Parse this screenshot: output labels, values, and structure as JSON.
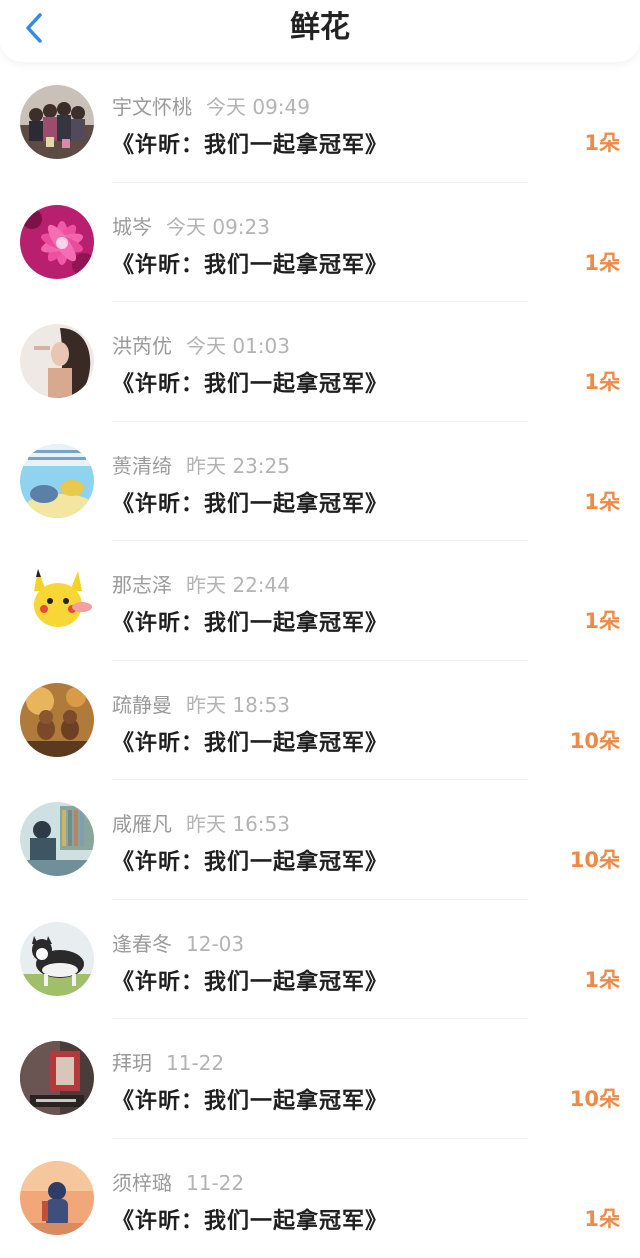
{
  "header": {
    "title": "鲜花"
  },
  "items": [
    {
      "name": "宇文怀桃",
      "time": "今天 09:49",
      "book": "《许昕：我们一起拿冠军》",
      "amount": "1朵"
    },
    {
      "name": "城岑",
      "time": "今天 09:23",
      "book": "《许昕：我们一起拿冠军》",
      "amount": "1朵"
    },
    {
      "name": "洪芮优",
      "time": "今天 01:03",
      "book": "《许昕：我们一起拿冠军》",
      "amount": "1朵"
    },
    {
      "name": "蒉清绮",
      "time": "昨天 23:25",
      "book": "《许昕：我们一起拿冠军》",
      "amount": "1朵"
    },
    {
      "name": "那志泽",
      "time": "昨天 22:44",
      "book": "《许昕：我们一起拿冠军》",
      "amount": "1朵"
    },
    {
      "name": "疏静曼",
      "time": "昨天 18:53",
      "book": "《许昕：我们一起拿冠军》",
      "amount": "10朵"
    },
    {
      "name": "咸雁凡",
      "time": "昨天 16:53",
      "book": "《许昕：我们一起拿冠军》",
      "amount": "10朵"
    },
    {
      "name": "逢春冬",
      "time": "12-03",
      "book": "《许昕：我们一起拿冠军》",
      "amount": "1朵"
    },
    {
      "name": "拜玥",
      "time": "11-22",
      "book": "《许昕：我们一起拿冠军》",
      "amount": "10朵"
    },
    {
      "name": "须梓璐",
      "time": "11-22",
      "book": "《许昕：我们一起拿冠军》",
      "amount": "1朵"
    }
  ],
  "colors": {
    "accent_back": "#2f8be6",
    "amount": "#ef8a46"
  }
}
